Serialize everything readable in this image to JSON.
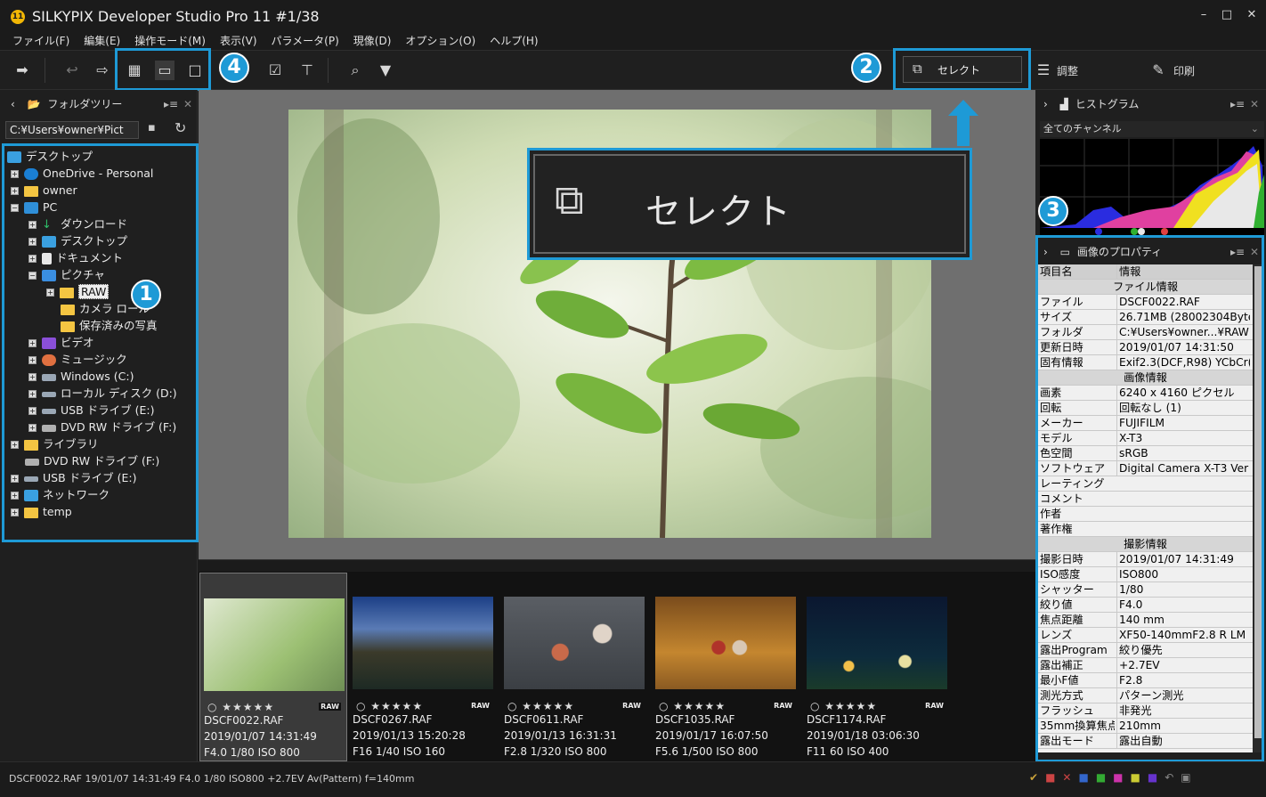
{
  "window": {
    "title": "SILKYPIX Developer Studio Pro 11   #1/38",
    "logo_text": "11",
    "controls": {
      "minimize": "–",
      "maximize": "□",
      "close": "✕"
    }
  },
  "menu": [
    "ファイル(F)",
    "編集(E)",
    "操作モード(M)",
    "表示(V)",
    "パラメータ(P)",
    "現像(D)",
    "オプション(O)",
    "ヘルプ(H)"
  ],
  "toolbar": {
    "select_label": "セレクト",
    "adjust_label": "調整",
    "print_label": "印刷"
  },
  "callouts": {
    "one": "1",
    "two": "2",
    "three": "3",
    "four": "4"
  },
  "left_panel": {
    "title": "フォルダツリー",
    "path": "C:¥Users¥owner¥Pict",
    "tree": [
      {
        "label": "デスクトップ"
      },
      {
        "label": "OneDrive - Personal"
      },
      {
        "label": "owner"
      },
      {
        "label": "PC"
      },
      {
        "label": "ダウンロード"
      },
      {
        "label": "デスクトップ"
      },
      {
        "label": "ドキュメント"
      },
      {
        "label": "ピクチャ"
      },
      {
        "label": "RAW"
      },
      {
        "label": "カメラ ロール"
      },
      {
        "label": "保存済みの写真"
      },
      {
        "label": "ビデオ"
      },
      {
        "label": "ミュージック"
      },
      {
        "label": "Windows (C:)"
      },
      {
        "label": "ローカル ディスク (D:)"
      },
      {
        "label": "USB ドライブ (E:)"
      },
      {
        "label": "DVD RW ドライブ (F:)"
      },
      {
        "label": "ライブラリ"
      },
      {
        "label": "DVD RW ドライブ (F:)"
      },
      {
        "label": "USB ドライブ (E:)"
      },
      {
        "label": "ネットワーク"
      },
      {
        "label": "temp"
      }
    ]
  },
  "main": {
    "zoom_select_label": "セレクト"
  },
  "filmstrip": [
    {
      "file": "DSCF0022.RAF",
      "date": "2019/01/07 14:31:49",
      "exposure": "F4.0 1/80 ISO 800",
      "stars": "○ ★★★★★",
      "raw": "RAW"
    },
    {
      "file": "DSCF0267.RAF",
      "date": "2019/01/13 15:20:28",
      "exposure": "F16 1/40 ISO 160",
      "stars": "○ ★★★★★",
      "raw": "RAW"
    },
    {
      "file": "DSCF0611.RAF",
      "date": "2019/01/13 16:31:31",
      "exposure": "F2.8 1/320 ISO 800",
      "stars": "○ ★★★★★",
      "raw": "RAW"
    },
    {
      "file": "DSCF1035.RAF",
      "date": "2019/01/17 16:07:50",
      "exposure": "F5.6 1/500 ISO 800",
      "stars": "○ ★★★★★",
      "raw": "RAW"
    },
    {
      "file": "DSCF1174.RAF",
      "date": "2019/01/18 03:06:30",
      "exposure": "F11 60 ISO 400",
      "stars": "○ ★★★★★",
      "raw": "RAW"
    }
  ],
  "histogram": {
    "title": "ヒストグラム",
    "channel": "全てのチャンネル"
  },
  "properties": {
    "title": "画像のプロパティ",
    "col_name": "項目名",
    "col_info": "情報",
    "rows": [
      {
        "section": "ファイル情報"
      },
      {
        "k": "ファイル",
        "v": "DSCF0022.RAF"
      },
      {
        "k": "サイズ",
        "v": "26.71MB (28002304Byte"
      },
      {
        "k": "フォルダ",
        "v": "C:¥Users¥owner...¥RAW"
      },
      {
        "k": "更新日時",
        "v": "2019/01/07 14:31:50"
      },
      {
        "k": "固有情報",
        "v": "Exif2.3(DCF,R98) YCbCr("
      },
      {
        "section": "画像情報"
      },
      {
        "k": "画素",
        "v": "6240 x 4160 ピクセル"
      },
      {
        "k": "回転",
        "v": "回転なし (1)"
      },
      {
        "k": "メーカー",
        "v": "FUJIFILM"
      },
      {
        "k": "モデル",
        "v": "X-T3"
      },
      {
        "k": "色空間",
        "v": "sRGB"
      },
      {
        "k": "ソフトウェア",
        "v": "Digital Camera X-T3 Ver"
      },
      {
        "k": "レーティング",
        "v": ""
      },
      {
        "k": "コメント",
        "v": ""
      },
      {
        "k": "作者",
        "v": ""
      },
      {
        "k": "著作権",
        "v": ""
      },
      {
        "section": "撮影情報"
      },
      {
        "k": "撮影日時",
        "v": "2019/01/07 14:31:49"
      },
      {
        "k": "ISO感度",
        "v": "ISO800"
      },
      {
        "k": "シャッター",
        "v": "1/80"
      },
      {
        "k": "絞り値",
        "v": "F4.0"
      },
      {
        "k": "焦点距離",
        "v": "140 mm"
      },
      {
        "k": "レンズ",
        "v": "XF50-140mmF2.8 R LM"
      },
      {
        "k": "露出Program",
        "v": "絞り優先"
      },
      {
        "k": "露出補正",
        "v": "+2.7EV"
      },
      {
        "k": "最小F値",
        "v": "F2.8"
      },
      {
        "k": "測光方式",
        "v": "パターン測光"
      },
      {
        "k": "フラッシュ",
        "v": "非発光"
      },
      {
        "k": "35mm換算焦点",
        "v": "210mm"
      },
      {
        "k": "露出モード",
        "v": "露出自動"
      }
    ]
  },
  "status": {
    "text": "DSCF0022.RAF 19/01/07 14:31:49 F4.0 1/80 ISO800 +2.7EV Av(Pattern) f=140mm"
  },
  "colors": {
    "accent": "#1e9ad6",
    "folder": "#f4c542"
  }
}
